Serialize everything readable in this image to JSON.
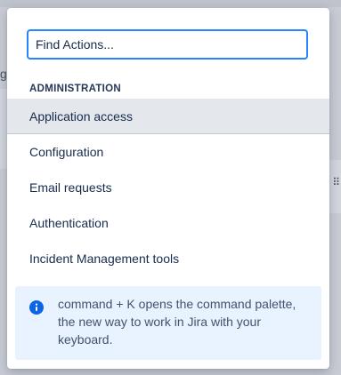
{
  "search": {
    "placeholder": "Find Actions..."
  },
  "section": {
    "heading": "ADMINISTRATION"
  },
  "menu": {
    "items": [
      {
        "label": "Application access",
        "active": true
      },
      {
        "label": "Configuration",
        "active": false
      },
      {
        "label": "Email requests",
        "active": false
      },
      {
        "label": "Authentication",
        "active": false
      },
      {
        "label": "Incident Management tools",
        "active": false
      }
    ]
  },
  "info": {
    "icon": "info-icon",
    "text": "command + K opens the command palette, the new way to work in Jira with your keyboard."
  },
  "colors": {
    "focus_border": "#2684ff",
    "info_icon": "#0c66e4",
    "info_bg": "#e9f2ff",
    "active_item_bg": "#e4e7ec"
  }
}
